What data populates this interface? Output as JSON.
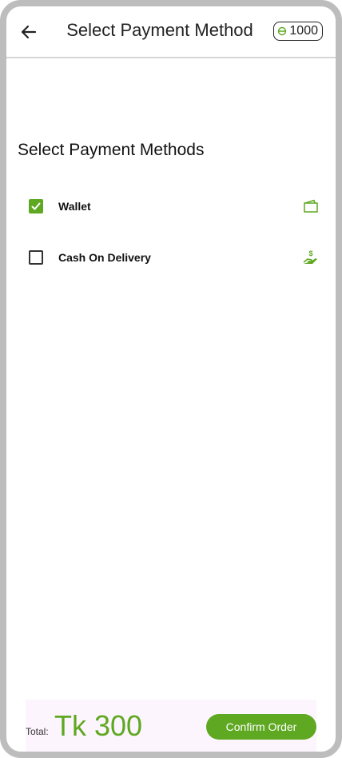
{
  "header": {
    "title": "Select Payment Method",
    "back_icon": "arrow-left-icon",
    "coin_icon": "coin-icon",
    "coin_balance": "1000"
  },
  "section": {
    "title": "Select Payment Methods"
  },
  "payment_options": [
    {
      "label": "Wallet",
      "checked": true,
      "icon": "wallet-icon"
    },
    {
      "label": "Cash On Delivery",
      "checked": false,
      "icon": "cash-hand-icon"
    }
  ],
  "footer": {
    "total_label": "Total:",
    "total_value": "Tk 300",
    "confirm_label": "Confirm Order"
  },
  "colors": {
    "accent": "#5fa822",
    "footer_bg": "#fdf5fd",
    "frame": "#bdbdbd"
  }
}
